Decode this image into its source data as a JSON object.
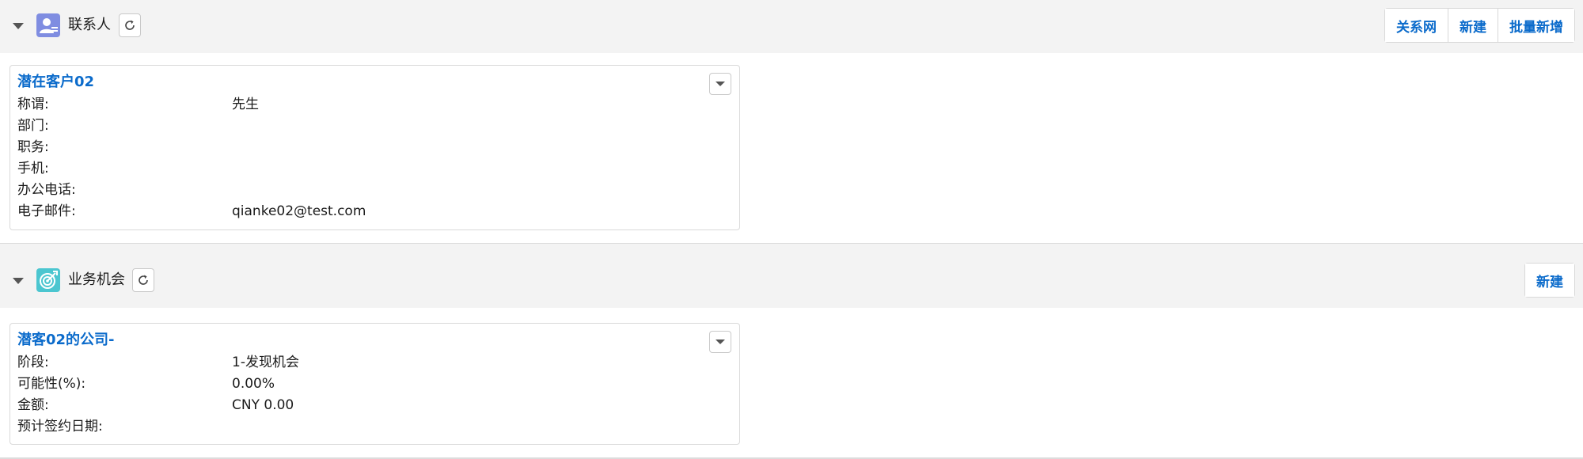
{
  "contacts": {
    "title": "联系人",
    "icon": "contact-icon",
    "icon_color": "#7f8de1",
    "buttons": [
      "关系网",
      "新建",
      "批量新增"
    ],
    "card": {
      "title": "潜在客户02",
      "fields": [
        {
          "label": "称谓:",
          "value": "先生"
        },
        {
          "label": "部门:",
          "value": ""
        },
        {
          "label": "职务:",
          "value": ""
        },
        {
          "label": "手机:",
          "value": ""
        },
        {
          "label": "办公电话:",
          "value": ""
        },
        {
          "label": "电子邮件:",
          "value": "qianke02@test.com"
        }
      ]
    }
  },
  "opportunities": {
    "title": "业务机会",
    "icon": "target-icon",
    "icon_color": "#4bc6d0",
    "buttons": [
      "新建"
    ],
    "card": {
      "title": "潜客02的公司-",
      "fields": [
        {
          "label": "阶段:",
          "value": "1-发现机会"
        },
        {
          "label": "可能性(%):",
          "value": "0.00%"
        },
        {
          "label": "金额:",
          "value": "CNY 0.00"
        },
        {
          "label": "预计签约日期:",
          "value": ""
        }
      ]
    }
  },
  "colors": {
    "link_blue": "#0b6bcb",
    "header_bg": "#f3f3f3",
    "border": "#d9d9d9"
  }
}
